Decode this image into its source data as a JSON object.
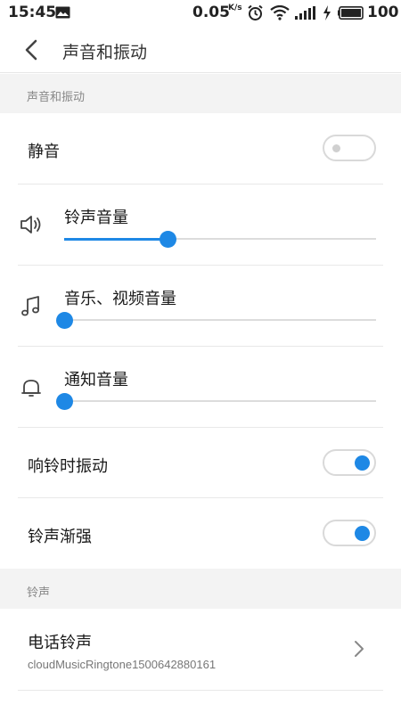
{
  "status_bar": {
    "time": "15:45",
    "net_speed": "0.05",
    "net_speed_unit": "K/s",
    "battery": "100"
  },
  "header": {
    "title": "声音和振动"
  },
  "sections": {
    "sound": {
      "title": "声音和振动"
    },
    "ringtone": {
      "title": "铃声"
    }
  },
  "rows": {
    "mute": {
      "label": "静音",
      "enabled": false
    },
    "ring_volume": {
      "label": "铃声音量",
      "level": 0.33
    },
    "media_volume": {
      "label": "音乐、视频音量",
      "level": 0.0
    },
    "notification_volume": {
      "label": "通知音量",
      "level": 0.0
    },
    "vibrate_on_ring": {
      "label": "响铃时振动",
      "enabled": true
    },
    "ring_crescendo": {
      "label": "铃声渐强",
      "enabled": true
    },
    "phone_ringtone": {
      "label": "电话铃声",
      "value": "cloudMusicRingtone1500642880161"
    }
  },
  "accent_color": "#1e88e5"
}
